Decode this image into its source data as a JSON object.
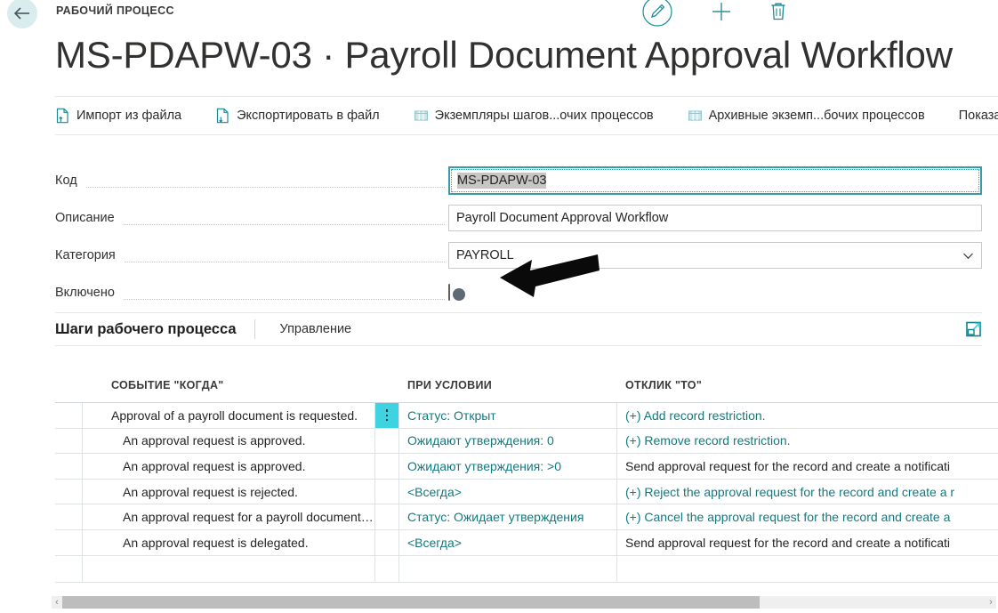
{
  "topbar": {
    "back_icon": "arrow-left-icon",
    "breadcrumb": "РАБОЧИЙ ПРОЦЕСС",
    "actions": [
      {
        "icon": "edit-pencil-icon",
        "name": "edit-button"
      },
      {
        "icon": "plus-icon",
        "name": "new-button"
      },
      {
        "icon": "trash-icon",
        "name": "delete-button"
      }
    ]
  },
  "page_title": "MS-PDAPW-03 · Payroll Document Approval Workflow",
  "actionbar": {
    "items": [
      {
        "label": "Импорт из файла",
        "icon": "file-import-icon"
      },
      {
        "label": "Экспортировать в файл",
        "icon": "file-export-icon"
      },
      {
        "label": "Экземпляры шагов...очих процессов",
        "icon": "table-icon"
      },
      {
        "label": "Архивные экземп...бочих процессов",
        "icon": "table-icon"
      },
      {
        "label": "Показа",
        "icon": ""
      }
    ]
  },
  "form": {
    "code": {
      "label": "Код",
      "value": "MS-PDAPW-03",
      "focused": true
    },
    "description": {
      "label": "Описание",
      "value": "Payroll Document Approval Workflow"
    },
    "category": {
      "label": "Категория",
      "value": "PAYROLL",
      "chevron": "chevron-down-icon"
    },
    "enabled": {
      "label": "Включено",
      "value": "off"
    }
  },
  "section": {
    "title": "Шаги рабочего процесса",
    "tab": "Управление",
    "expand_icon": "expand-icon"
  },
  "grid": {
    "columns": [
      "СОБЫТИЕ \"КОГДА\"",
      "ПРИ УСЛОВИИ",
      "ОТКЛИК \"ТО\""
    ],
    "rows": [
      {
        "when": "Approval of a payroll document is requested.",
        "condition": "Статус: Открыт",
        "response": "(+) Add record restriction.",
        "indent": false,
        "condition_teal": true,
        "response_teal": true,
        "has_dots": true
      },
      {
        "when": "An approval request is approved.",
        "condition": "Ожидают утверждения: 0",
        "response": "(+) Remove record restriction.",
        "indent": true,
        "condition_teal": true,
        "response_teal": true,
        "has_dots": false
      },
      {
        "when": "An approval request is approved.",
        "condition": "Ожидают утверждения: >0",
        "response": "Send approval request for the record and create a notificati",
        "indent": true,
        "condition_teal": true,
        "response_teal": false,
        "has_dots": false
      },
      {
        "when": "An approval request is rejected.",
        "condition": "<Всегда>",
        "response": "(+) Reject the approval request for the record and create a r",
        "indent": true,
        "condition_teal": true,
        "response_teal": true,
        "has_dots": false
      },
      {
        "when": "An approval request for a payroll document…",
        "condition": "Статус: Ожидает утверждения",
        "response": "(+) Cancel the approval request for the record and create a",
        "indent": true,
        "condition_teal": true,
        "response_teal": true,
        "has_dots": false
      },
      {
        "when": "An approval request is delegated.",
        "condition": "<Всегда>",
        "response": "Send approval request for the record and create a notificati",
        "indent": true,
        "condition_teal": true,
        "response_teal": false,
        "has_dots": false
      },
      {
        "when": "",
        "condition": "",
        "response": "",
        "indent": true,
        "condition_teal": false,
        "response_teal": false,
        "has_dots": false
      }
    ]
  },
  "scrollbar": {
    "left_arrow": "‹",
    "right_arrow": "›"
  },
  "colors": {
    "accent_teal": "#117a80",
    "dots_button": "#3fd2e0",
    "back_circle": "#d9ecee"
  }
}
